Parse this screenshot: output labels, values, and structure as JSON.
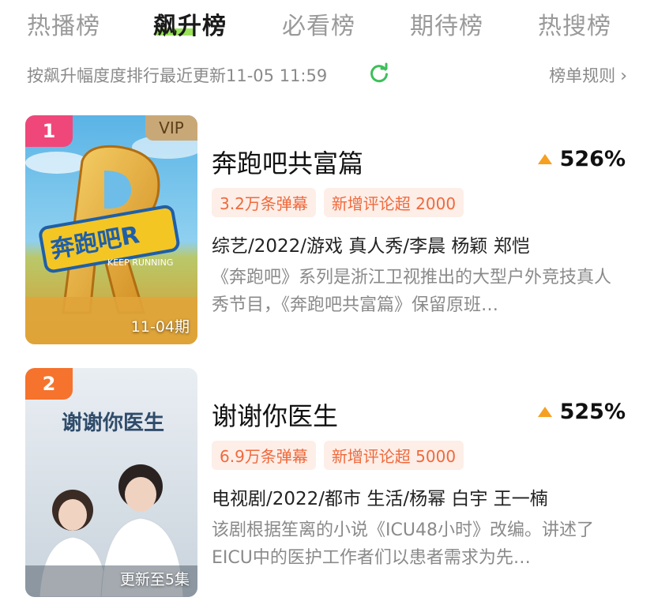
{
  "tabs": [
    {
      "label": "热播榜",
      "active": false
    },
    {
      "label": "飙升榜",
      "active": true
    },
    {
      "label": "必看榜",
      "active": false
    },
    {
      "label": "期待榜",
      "active": false
    },
    {
      "label": "热搜榜",
      "active": false
    }
  ],
  "subheader": {
    "text": "按飙升幅度度排行最近更新11-05 11:59",
    "rules_label": "榜单规则",
    "refresh_icon": "refresh-icon",
    "accent": "#3cc05a"
  },
  "items": [
    {
      "rank": "1",
      "rank_color": "#f0477a",
      "vip": "VIP",
      "poster_caption": "11-04期",
      "title": "奔跑吧共富篇",
      "growth": "526%",
      "badges": [
        "3.2万条弹幕",
        "新增评论超 2000"
      ],
      "meta": "综艺/2022/游戏 真人秀/李晨 杨颖 郑恺",
      "desc": "《奔跑吧》系列是浙江卫视推出的大型户外竞技真人秀节目，《奔跑吧共富篇》保留原班…"
    },
    {
      "rank": "2",
      "rank_color": "#f5732c",
      "poster_caption": "更新至5集",
      "poster_title": "谢谢你医生",
      "title": "谢谢你医生",
      "growth": "525%",
      "badges": [
        "6.9万条弹幕",
        "新增评论超 5000"
      ],
      "meta": "电视剧/2022/都市 生活/杨幂 白宇 王一楠",
      "desc": "该剧根据笙离的小说《ICU48小时》改编。讲述了EICU中的医护工作者们以患者需求为先…"
    }
  ]
}
